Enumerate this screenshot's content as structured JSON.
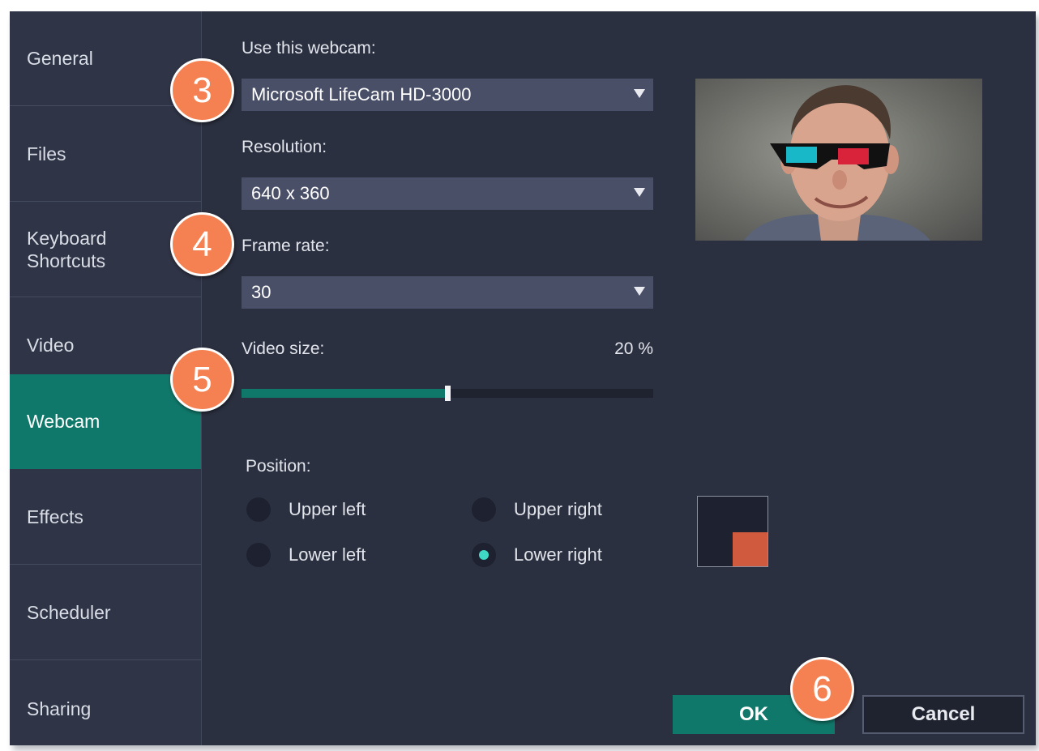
{
  "sidebar": {
    "items": [
      {
        "label": "General",
        "active": false
      },
      {
        "label": "Files",
        "active": false
      },
      {
        "label": "Keyboard\nShortcuts",
        "active": false
      },
      {
        "label": "Video",
        "active": false
      },
      {
        "label": "Webcam",
        "active": true
      },
      {
        "label": "Effects",
        "active": false
      },
      {
        "label": "Scheduler",
        "active": false
      },
      {
        "label": "Sharing",
        "active": false
      }
    ]
  },
  "webcam": {
    "label": "Use this webcam:",
    "value": "Microsoft LifeCam HD-3000"
  },
  "resolution": {
    "label": "Resolution:",
    "value": "640 x 360"
  },
  "frame_rate": {
    "label": "Frame rate:",
    "value": "30"
  },
  "video_size": {
    "label": "Video size:",
    "value_text": "20 %",
    "slider_fraction": 0.5
  },
  "position": {
    "label": "Position:",
    "options": [
      {
        "label": "Upper left",
        "checked": false
      },
      {
        "label": "Upper right",
        "checked": false
      },
      {
        "label": "Lower left",
        "checked": false
      },
      {
        "label": "Lower right",
        "checked": true
      }
    ]
  },
  "buttons": {
    "ok": "OK",
    "cancel": "Cancel"
  },
  "markers": [
    "3",
    "4",
    "5",
    "6"
  ],
  "colors": {
    "accent": "#10786a",
    "marker": "#f58152",
    "webcam_position": "#cf5a3e",
    "radio_checked": "#3ed8c5"
  }
}
